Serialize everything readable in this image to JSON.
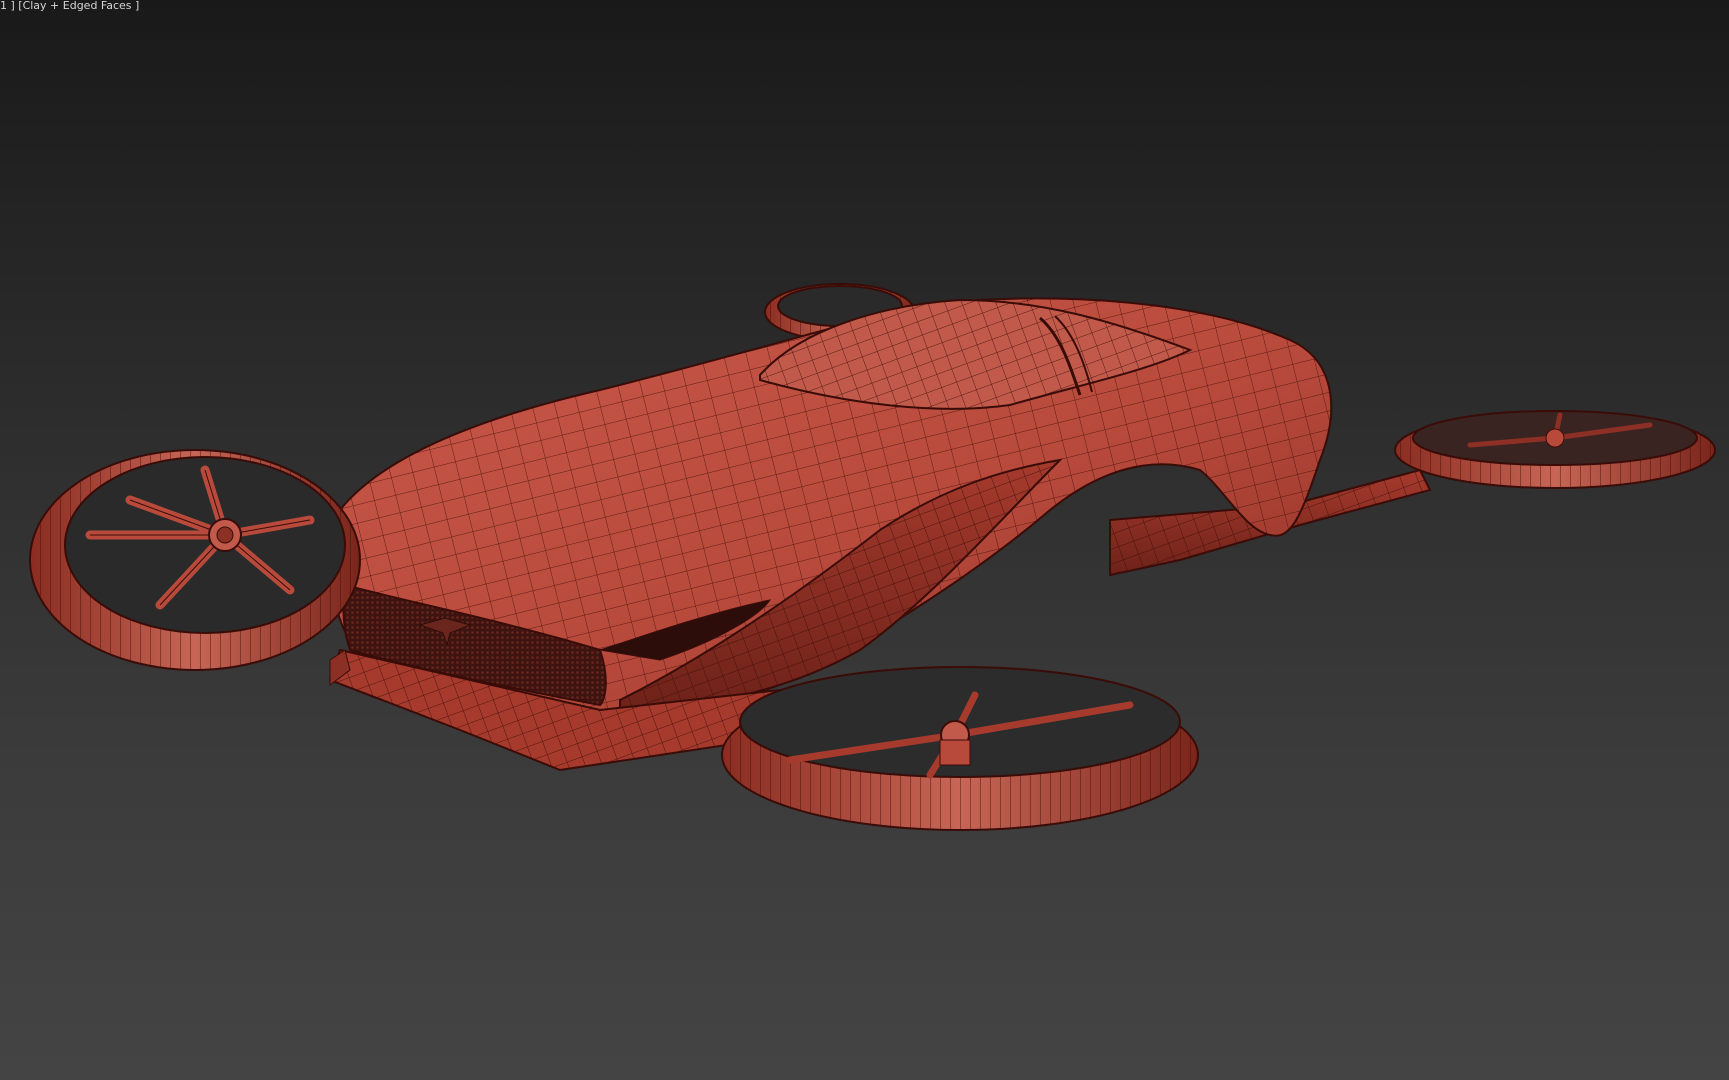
{
  "viewport": {
    "label": "1 ] [Clay + Edged Faces ]",
    "shading_mode": "Clay + Edged Faces",
    "colors": {
      "background_top": "#191919",
      "background_bottom": "#444444",
      "clay": "#b84a3c",
      "clay_dark": "#6e2219",
      "clay_light": "#cc6a5c",
      "wire": "#3a0c08"
    }
  },
  "model": {
    "name": "flying-car-model",
    "rotor_icons": [
      "rotor-icon",
      "rotor-icon",
      "rotor-icon",
      "rotor-icon"
    ]
  }
}
